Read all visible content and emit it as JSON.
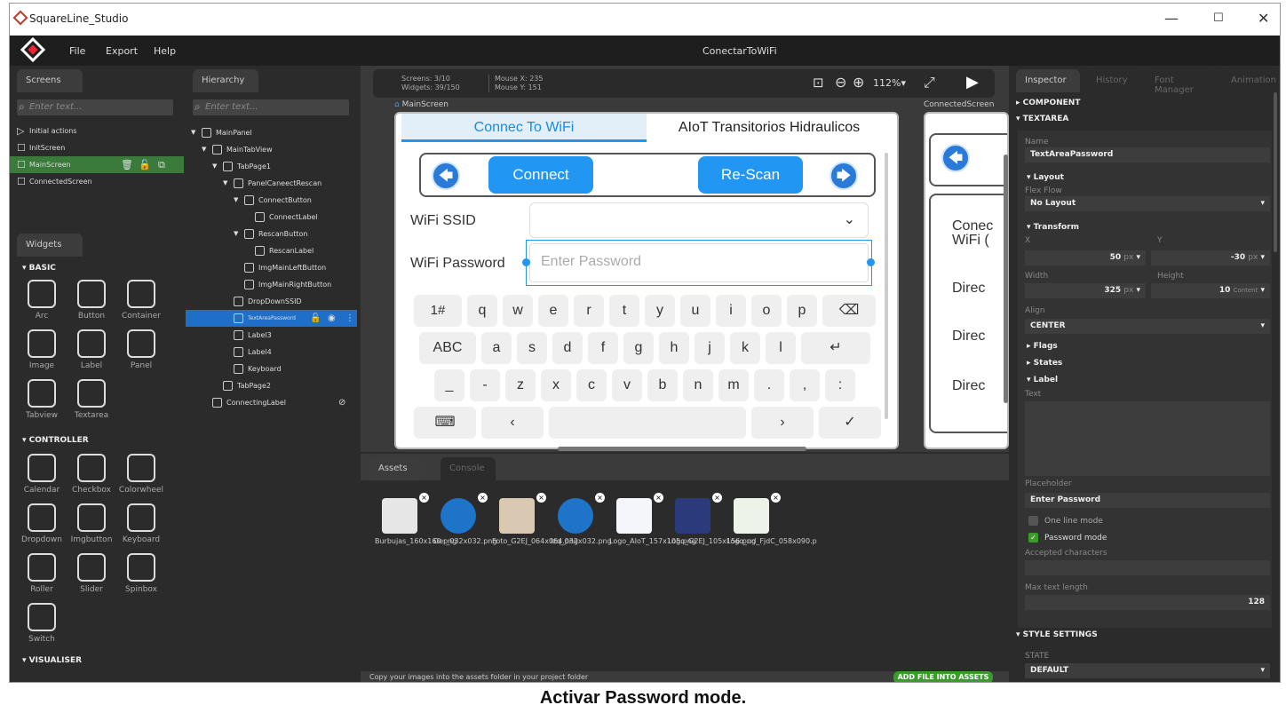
{
  "app": {
    "title": "SquareLine_Studio",
    "project": "ConectarToWiFi",
    "menu": [
      "File",
      "Export",
      "Help"
    ],
    "window_controls": {
      "min": "—",
      "max": "☐",
      "close": "✕"
    }
  },
  "screens_panel": {
    "tab": "Screens",
    "search_placeholder": "Enter text...",
    "items": [
      {
        "label": "Initial actions",
        "icon": "play-icon"
      },
      {
        "label": "InitScreen",
        "icon": "screen-icon"
      },
      {
        "label": "MainScreen",
        "icon": "screen-icon",
        "selected": true
      },
      {
        "label": "ConnectedScreen",
        "icon": "screen-icon"
      }
    ],
    "row_icons": {
      "trash": "🗑",
      "lock": "🔓",
      "copy": "⧉"
    }
  },
  "hierarchy": {
    "tab": "Hierarchy",
    "search_placeholder": "Enter text...",
    "items": [
      {
        "label": "MainPanel",
        "depth": 0,
        "arrow": "▼"
      },
      {
        "label": "MainTabView",
        "depth": 1,
        "arrow": "▼"
      },
      {
        "label": "TabPage1",
        "depth": 2,
        "arrow": "▼"
      },
      {
        "label": "PanelCaneectRescan",
        "depth": 3,
        "arrow": "▼"
      },
      {
        "label": "ConnectButton",
        "depth": 4,
        "arrow": "▼"
      },
      {
        "label": "ConnectLabel",
        "depth": 5,
        "arrow": ""
      },
      {
        "label": "RescanButton",
        "depth": 4,
        "arrow": "▼"
      },
      {
        "label": "RescanLabel",
        "depth": 5,
        "arrow": ""
      },
      {
        "label": "ImgMainLeftButton",
        "depth": 4,
        "arrow": ""
      },
      {
        "label": "ImgMainRightButton",
        "depth": 4,
        "arrow": ""
      },
      {
        "label": "DropDownSSID",
        "depth": 3,
        "arrow": ""
      },
      {
        "label": "TextAreaPassword",
        "depth": 3,
        "arrow": "",
        "selected": true
      },
      {
        "label": "Label3",
        "depth": 3,
        "arrow": ""
      },
      {
        "label": "Label4",
        "depth": 3,
        "arrow": ""
      },
      {
        "label": "Keyboard",
        "depth": 3,
        "arrow": ""
      },
      {
        "label": "TabPage2",
        "depth": 2,
        "arrow": ""
      },
      {
        "label": "ConnectingLabel",
        "depth": 1,
        "arrow": ""
      }
    ]
  },
  "widgets": {
    "tab": "Widgets",
    "basic_title": "BASIC",
    "basic": [
      "Arc",
      "Button",
      "Container",
      "Image",
      "Label",
      "Panel",
      "Tabview",
      "Textarea"
    ],
    "controller_title": "CONTROLLER",
    "controller": [
      "Calendar",
      "Checkbox",
      "Colorwheel",
      "Dropdown",
      "Imgbutton",
      "Keyboard",
      "Roller",
      "Slider",
      "Spinbox",
      "Switch"
    ],
    "visualiser_title": "VISUALISER"
  },
  "canvas": {
    "screens": "Screens: 3/10",
    "widgets": "Widgets: 39/150",
    "mouse_x": "Mouse X: 235",
    "mouse_y": "Mouse Y: 151",
    "zoom": "112%",
    "screen1": "MainScreen",
    "screen2": "ConnectedScreen"
  },
  "device": {
    "tab1": "Connec To WiFi",
    "tab2": "AIoT Transitorios Hidraulicos",
    "connect": "Connect",
    "rescan": "Re-Scan",
    "ssid_label": "WiFi SSID",
    "pwd_label": "WiFi Password",
    "pwd_placeholder": "Enter Password",
    "rows": [
      [
        "1#",
        "q",
        "w",
        "e",
        "r",
        "t",
        "y",
        "u",
        "i",
        "o",
        "p",
        "⌫"
      ],
      [
        "ABC",
        "a",
        "s",
        "d",
        "f",
        "g",
        "h",
        "j",
        "k",
        "l",
        "↵"
      ],
      [
        "_",
        "-",
        "z",
        "x",
        "c",
        "v",
        "b",
        "n",
        "m",
        ".",
        ",",
        ":"
      ],
      [
        "⌨",
        "‹",
        "",
        "›",
        "✓"
      ]
    ],
    "screen2_labels": [
      "Conec",
      "WiFi (",
      "Direc",
      "Direc",
      "Direc"
    ]
  },
  "assets": {
    "tab": "Assets",
    "tab2": "Console",
    "files": [
      "Burbujas_160x160.png",
      "Der_032x032.png",
      "Foto_G2EJ_064x064.png",
      "Izq_032x032.png",
      "Logo_AIoT_157x105.png",
      "Logo_G2EJ_105x156.png",
      "Logo_ud_FjdC_058x090.p"
    ],
    "hint": "Copy your images into the assets folder in your project folder",
    "add_button": "ADD FILE INTO ASSETS"
  },
  "inspector": {
    "tabs": [
      "Inspector",
      "History",
      "Font Manager",
      "Animation"
    ],
    "component": "COMPONENT",
    "textarea": "TEXTAREA",
    "name_label": "Name",
    "name": "TextAreaPassword",
    "layout": "Layout",
    "flex_flow": "Flex Flow",
    "flex_value": "No Layout",
    "transform": "Transform",
    "x_label": "X",
    "y_label": "Y",
    "x": "50",
    "y": "-30",
    "unit": "px",
    "width_label": "Width",
    "height_label": "Height",
    "width": "325",
    "height": "10",
    "height_unit": "Content",
    "align_label": "Align",
    "align": "CENTER",
    "flags": "Flags",
    "states": "States",
    "label": "Label",
    "text_label": "Text",
    "placeholder_label": "Placeholder",
    "placeholder": "Enter Password",
    "one_line": "One line mode",
    "password_mode": "Password mode",
    "accepted": "Accepted characters",
    "max_len_label": "Max text length",
    "max_len": "128",
    "style_settings": "STYLE SETTINGS",
    "state_label": "STATE",
    "state": "DEFAULT"
  },
  "caption": "Activar Password mode."
}
